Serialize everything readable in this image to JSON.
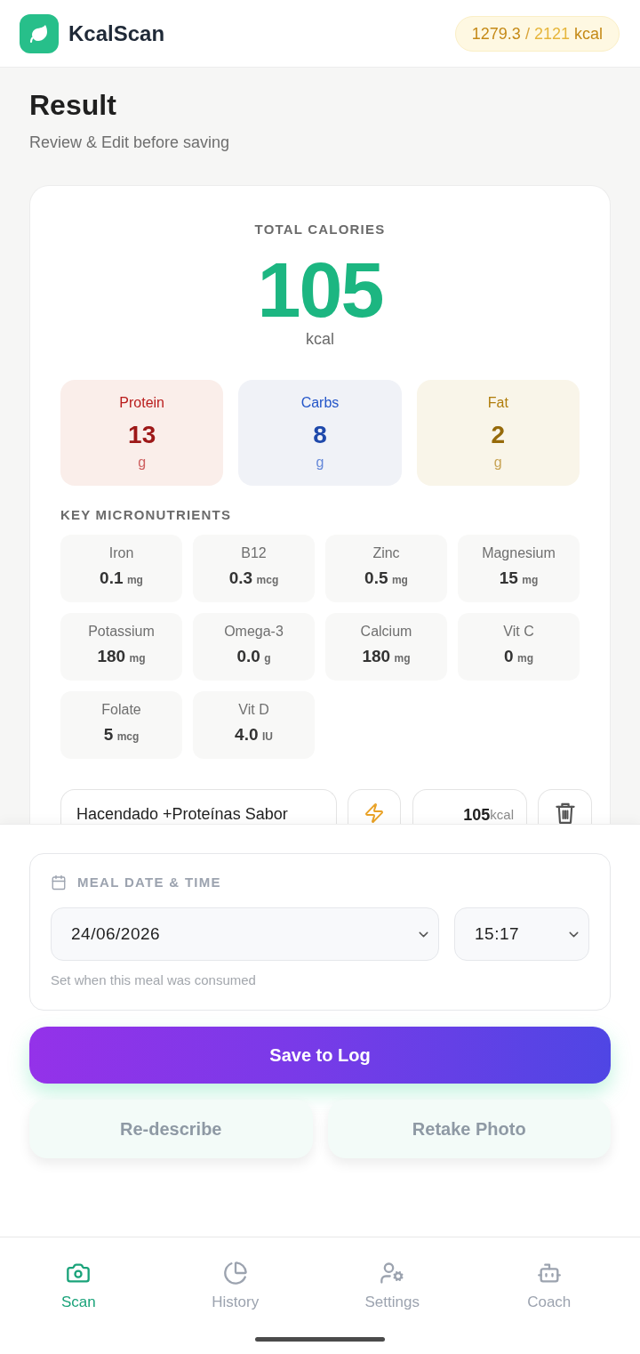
{
  "header": {
    "app_name": "KcalScan",
    "calorie_pill": {
      "consumed": "1279.3",
      "separator": "/",
      "goal": "2121",
      "unit": "kcal"
    }
  },
  "page": {
    "title": "Result",
    "subtitle": "Review & Edit before saving"
  },
  "total_calories": {
    "label": "TOTAL CALORIES",
    "value": "105",
    "unit": "kcal"
  },
  "macros": [
    {
      "label": "Protein",
      "value": "13",
      "unit": "g",
      "color": "#b91c1c"
    },
    {
      "label": "Carbs",
      "value": "8",
      "unit": "g",
      "color": "#2456c9"
    },
    {
      "label": "Fat",
      "value": "2",
      "unit": "g",
      "color": "#b07d0c"
    }
  ],
  "micronutrients": {
    "title": "KEY MICRONUTRIENTS",
    "items": [
      {
        "name": "Iron",
        "value": "0.1",
        "unit": "mg"
      },
      {
        "name": "B12",
        "value": "0.3",
        "unit": "mcg"
      },
      {
        "name": "Zinc",
        "value": "0.5",
        "unit": "mg"
      },
      {
        "name": "Magnesium",
        "value": "15",
        "unit": "mg"
      },
      {
        "name": "Potassium",
        "value": "180",
        "unit": "mg"
      },
      {
        "name": "Omega-3",
        "value": "0.0",
        "unit": "g"
      },
      {
        "name": "Calcium",
        "value": "180",
        "unit": "mg"
      },
      {
        "name": "Vit C",
        "value": "0",
        "unit": "mg"
      },
      {
        "name": "Folate",
        "value": "5",
        "unit": "mcg"
      },
      {
        "name": "Vit D",
        "value": "4.0",
        "unit": "IU"
      }
    ]
  },
  "food_item": {
    "name": "Hacendado +Proteínas Sabor",
    "calories": "105",
    "unit": "kcal"
  },
  "meal_time": {
    "title": "MEAL DATE & TIME",
    "date": "24/06/2026",
    "time": "15:17",
    "hint": "Set when this meal was consumed"
  },
  "actions": {
    "save": "Save to Log",
    "secondary": [
      {
        "label": "Re-describe",
        "disabled": true
      },
      {
        "label": "Retake Photo",
        "disabled": true
      }
    ]
  },
  "nav": [
    {
      "label": "Scan",
      "selected": true
    },
    {
      "label": "History",
      "selected": false
    },
    {
      "label": "Settings",
      "selected": false
    },
    {
      "label": "Coach",
      "selected": false
    }
  ]
}
